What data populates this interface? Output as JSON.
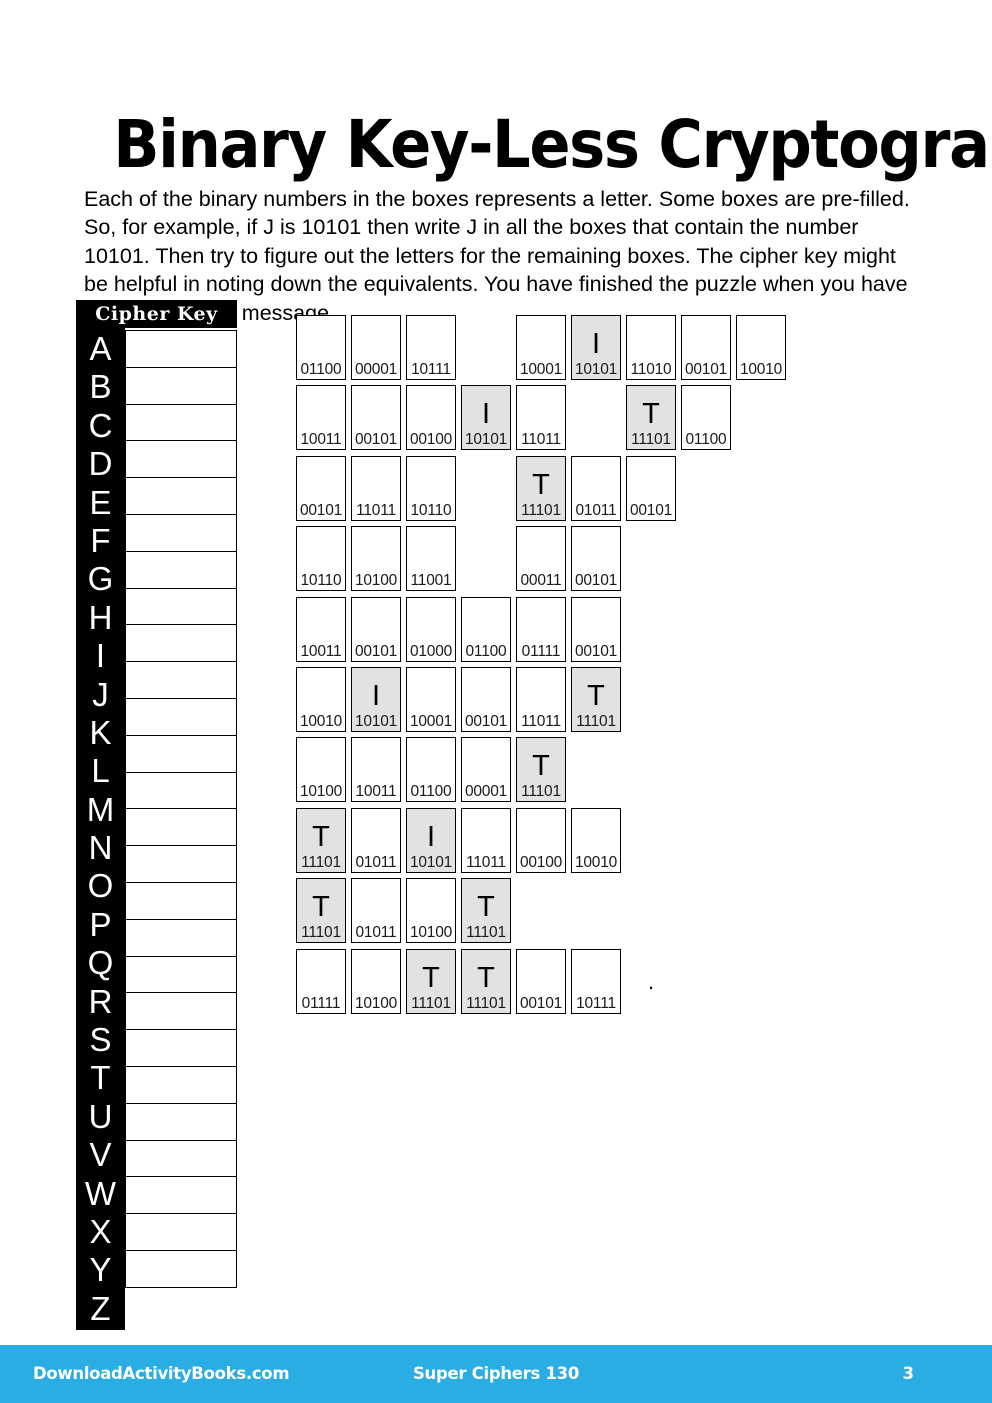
{
  "page": {
    "title": "Binary Key-Less Cryptogram",
    "instructions": "Each of the binary numbers in the boxes represents a letter. Some boxes are pre-filled. So, for example, if J is 10101 then write J in all the boxes that contain the number 10101. Then try to figure out the letters for the remaining boxes. The cipher key might be helpful in noting down the equivalents. You have finished the puzzle when you have decoded the full message.",
    "background_color": "#ffffff"
  },
  "cipher_key": {
    "header": "Cipher Key",
    "header_bg": "#000000",
    "header_color": "#ffffff",
    "letters": [
      "A",
      "B",
      "C",
      "D",
      "E",
      "F",
      "G",
      "H",
      "I",
      "J",
      "K",
      "L",
      "M",
      "N",
      "O",
      "P",
      "Q",
      "R",
      "S",
      "T",
      "U",
      "V",
      "W",
      "X",
      "Y",
      "Z"
    ],
    "answers": [
      "",
      "",
      "",
      "",
      "",
      "",
      "",
      "",
      "",
      "",
      "",
      "",
      "",
      "",
      "",
      "",
      "",
      "",
      "",
      "",
      "",
      "",
      "",
      "",
      "",
      ""
    ]
  },
  "puzzle": {
    "shaded_color": "#e2e2e2",
    "rows": [
      {
        "cells": [
          {
            "code": "01100",
            "letter": "",
            "shaded": false
          },
          {
            "code": "00001",
            "letter": "",
            "shaded": false
          },
          {
            "code": "10111",
            "letter": "",
            "shaded": false
          },
          {
            "type": "space"
          },
          {
            "code": "10001",
            "letter": "",
            "shaded": false
          },
          {
            "code": "10101",
            "letter": "I",
            "shaded": true
          },
          {
            "code": "11010",
            "letter": "",
            "shaded": false
          },
          {
            "code": "00101",
            "letter": "",
            "shaded": false
          },
          {
            "code": "10010",
            "letter": "",
            "shaded": false
          }
        ]
      },
      {
        "cells": [
          {
            "code": "10011",
            "letter": "",
            "shaded": false
          },
          {
            "code": "00101",
            "letter": "",
            "shaded": false
          },
          {
            "code": "00100",
            "letter": "",
            "shaded": false
          },
          {
            "code": "10101",
            "letter": "I",
            "shaded": true
          },
          {
            "code": "11011",
            "letter": "",
            "shaded": false
          },
          {
            "type": "space"
          },
          {
            "code": "11101",
            "letter": "T",
            "shaded": true
          },
          {
            "code": "01100",
            "letter": "",
            "shaded": false
          }
        ]
      },
      {
        "cells": [
          {
            "code": "00101",
            "letter": "",
            "shaded": false
          },
          {
            "code": "11011",
            "letter": "",
            "shaded": false
          },
          {
            "code": "10110",
            "letter": "",
            "shaded": false
          },
          {
            "type": "space"
          },
          {
            "code": "11101",
            "letter": "T",
            "shaded": true
          },
          {
            "code": "01011",
            "letter": "",
            "shaded": false
          },
          {
            "code": "00101",
            "letter": "",
            "shaded": false
          }
        ]
      },
      {
        "cells": [
          {
            "code": "10110",
            "letter": "",
            "shaded": false
          },
          {
            "code": "10100",
            "letter": "",
            "shaded": false
          },
          {
            "code": "11001",
            "letter": "",
            "shaded": false
          },
          {
            "type": "space"
          },
          {
            "code": "00011",
            "letter": "",
            "shaded": false
          },
          {
            "code": "00101",
            "letter": "",
            "shaded": false
          }
        ]
      },
      {
        "cells": [
          {
            "code": "10011",
            "letter": "",
            "shaded": false
          },
          {
            "code": "00101",
            "letter": "",
            "shaded": false
          },
          {
            "code": "01000",
            "letter": "",
            "shaded": false
          },
          {
            "code": "01100",
            "letter": "",
            "shaded": false
          },
          {
            "code": "01111",
            "letter": "",
            "shaded": false
          },
          {
            "code": "00101",
            "letter": "",
            "shaded": false
          }
        ]
      },
      {
        "cells": [
          {
            "code": "10010",
            "letter": "",
            "shaded": false
          },
          {
            "code": "10101",
            "letter": "I",
            "shaded": true
          },
          {
            "code": "10001",
            "letter": "",
            "shaded": false
          },
          {
            "code": "00101",
            "letter": "",
            "shaded": false
          },
          {
            "code": "11011",
            "letter": "",
            "shaded": false
          },
          {
            "code": "11101",
            "letter": "T",
            "shaded": true
          }
        ]
      },
      {
        "cells": [
          {
            "code": "10100",
            "letter": "",
            "shaded": false
          },
          {
            "code": "10011",
            "letter": "",
            "shaded": false
          },
          {
            "code": "01100",
            "letter": "",
            "shaded": false
          },
          {
            "code": "00001",
            "letter": "",
            "shaded": false
          },
          {
            "code": "11101",
            "letter": "T",
            "shaded": true
          }
        ]
      },
      {
        "cells": [
          {
            "code": "11101",
            "letter": "T",
            "shaded": true
          },
          {
            "code": "01011",
            "letter": "",
            "shaded": false
          },
          {
            "code": "10101",
            "letter": "I",
            "shaded": true
          },
          {
            "code": "11011",
            "letter": "",
            "shaded": false
          },
          {
            "code": "00100",
            "letter": "",
            "shaded": false
          },
          {
            "code": "10010",
            "letter": "",
            "shaded": false
          }
        ]
      },
      {
        "cells": [
          {
            "code": "11101",
            "letter": "T",
            "shaded": true
          },
          {
            "code": "01011",
            "letter": "",
            "shaded": false
          },
          {
            "code": "10100",
            "letter": "",
            "shaded": false
          },
          {
            "code": "11101",
            "letter": "T",
            "shaded": true
          }
        ]
      },
      {
        "cells": [
          {
            "code": "01111",
            "letter": "",
            "shaded": false
          },
          {
            "code": "10100",
            "letter": "",
            "shaded": false
          },
          {
            "code": "11101",
            "letter": "T",
            "shaded": true
          },
          {
            "code": "11101",
            "letter": "T",
            "shaded": true
          },
          {
            "code": "00101",
            "letter": "",
            "shaded": false
          },
          {
            "code": "10111",
            "letter": "",
            "shaded": false
          },
          {
            "type": "period",
            "text": "."
          }
        ]
      }
    ]
  },
  "footer": {
    "site": "DownloadActivityBooks.com",
    "book": "Super Ciphers 130",
    "page_number": "3",
    "background_color": "#29ade3",
    "text_color": "#ffffff"
  }
}
